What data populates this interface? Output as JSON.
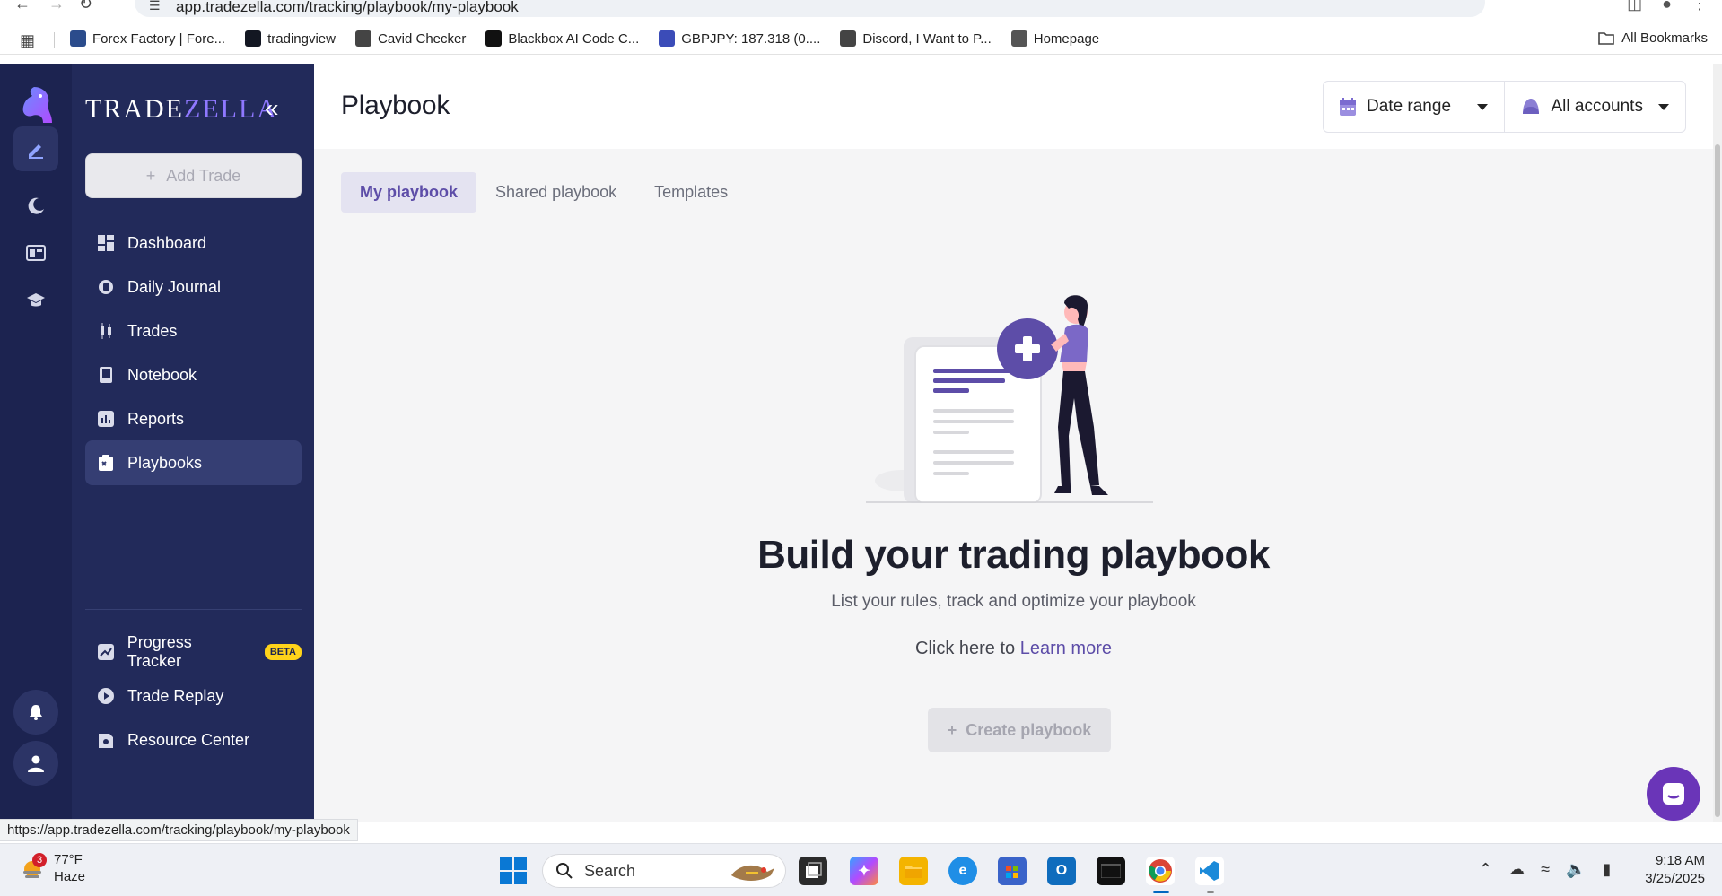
{
  "browser": {
    "url": "app.tradezella.com/tracking/playbook/my-playbook",
    "bookmarks": [
      {
        "label": "Forex Factory | Fore...",
        "color": "#2b4c8c"
      },
      {
        "label": "tradingview",
        "color": "#131722"
      },
      {
        "label": "Cavid Checker",
        "color": "#444444"
      },
      {
        "label": "Blackbox AI Code C...",
        "color": "#111111"
      },
      {
        "label": "GBPJPY: 187.318 (0....",
        "color": "#3b4cb8"
      },
      {
        "label": "Discord, I Want to P...",
        "color": "#444444"
      },
      {
        "label": "Homepage",
        "color": "#555555"
      }
    ],
    "all_bookmarks": "All Bookmarks",
    "status_url": "https://app.tradezella.com/tracking/playbook/my-playbook"
  },
  "sidebar": {
    "logo_trade": "TRADE",
    "logo_zella": "ZELLA",
    "add_trade": "Add Trade",
    "items": [
      {
        "label": "Dashboard",
        "icon": "dashboard-icon"
      },
      {
        "label": "Daily Journal",
        "icon": "journal-icon"
      },
      {
        "label": "Trades",
        "icon": "trades-icon"
      },
      {
        "label": "Notebook",
        "icon": "notebook-icon"
      },
      {
        "label": "Reports",
        "icon": "reports-icon"
      },
      {
        "label": "Playbooks",
        "icon": "playbooks-icon"
      },
      {
        "label": "Progress Tracker",
        "icon": "progress-icon"
      },
      {
        "label": "Trade Replay",
        "icon": "play-icon"
      },
      {
        "label": "Resource Center",
        "icon": "resource-icon"
      }
    ],
    "beta": "BETA",
    "active": "Playbooks"
  },
  "header": {
    "title": "Playbook",
    "date_range": "Date range",
    "accounts": "All accounts"
  },
  "tabs": [
    {
      "label": "My playbook",
      "active": true
    },
    {
      "label": "Shared playbook",
      "active": false
    },
    {
      "label": "Templates",
      "active": false
    }
  ],
  "empty_state": {
    "title": "Build your trading playbook",
    "subtitle": "List your rules, track and optimize your playbook",
    "learn_prefix": "Click here to",
    "learn_link": "Learn more",
    "create_button": "Create playbook"
  },
  "taskbar": {
    "weather_temp": "77°F",
    "weather_cond": "Haze",
    "weather_badge": "3",
    "search": "Search",
    "time": "9:18 AM",
    "date": "3/25/2025"
  },
  "colors": {
    "sidebar_bg": "#222a5a",
    "rail_bg": "#1c2350",
    "accent": "#5d4da8",
    "beta": "#ffd31a"
  }
}
